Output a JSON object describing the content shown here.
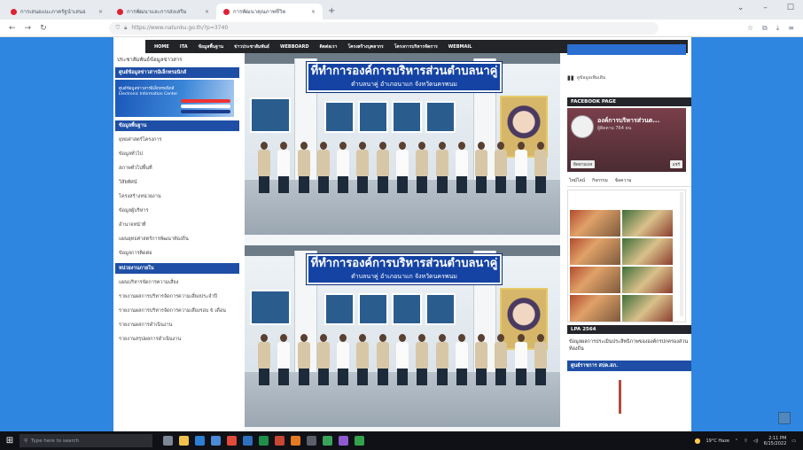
{
  "browser": {
    "tabs": [
      {
        "title": "การเสนอแนะภาครัฐนำเสนอ"
      },
      {
        "title": "การพัฒนาและการส่งเสริม"
      },
      {
        "title": "การพัฒนาคุณภาพชีวิต"
      }
    ],
    "new_tab_icon": "plus-icon",
    "url": "https://www.natunku.go.th/?p=3740"
  },
  "site": {
    "nav": [
      "HOME",
      "ITA",
      "ข้อมูลพื้นฐาน",
      "ข่าวประชาสัมพันธ์",
      "WEBBOARD",
      "ติดต่อเรา",
      "โครงสร้างบุคลากร",
      "โครงการบริหารจัดการ",
      "WEBMAIL"
    ],
    "left": {
      "intro": "ประชาสัมพันธ์ข้อมูลข่าวสาร",
      "sec1": "ศูนย์ข้อมูลข่าวสารอิเล็กทรอนิกส์",
      "banner_line1": "ศูนย์ข้อมูลข่าวสารอิเล็กทรอนิกส์",
      "banner_line2": "Electronic Information Center",
      "sec2": "ข้อมูลพื้นฐาน",
      "links1": [
        "ยุทธศาสตร์โครงการ",
        "ข้อมูลทั่วไป",
        "สภาพทั่วไปพื้นที่",
        "วิสัยทัศน์",
        "โครงสร้างหน่วยงาน",
        "ข้อมูลผู้บริหาร",
        "อำนาจหน้าที่",
        "แผนยุทธศาสตร์การพัฒนาท้องถิ่น",
        "ข้อมูลการติดต่อ"
      ],
      "sec3": "หน่วยงานภายใน",
      "links2": [
        "แผนบริหารจัดการความเสี่ยง",
        "รายงานผลการบริหารจัดการความเสี่ยงประจำปี",
        "รายงานผลการบริหารจัดการความเสี่ยงรอบ 6 เดือน",
        "รายงานผลการดำเนินงาน",
        "รายงานสรุปผลการดำเนินงาน"
      ]
    },
    "photo": {
      "sign_line1": "ที่ทำการองค์การบริหารส่วนตำบลนาคู่",
      "sign_line2": "ตำบลนาคู่ อำเภอนาแก จังหวัดนครพนม"
    },
    "right": {
      "stats": "ดูข้อมูลเพิ่มเติม",
      "fb_head": "FACEBOOK PAGE",
      "fb_name": "องค์การบริหารส่วนต...",
      "fb_sub": "ผู้ติดตาม 764 คน",
      "fb_follow": "ติดตามเพจ",
      "fb_share": "แชร์",
      "fb_tabs": [
        "ไทม์ไลน์",
        "กิจกรรม",
        "ข้อความ"
      ],
      "lpa_head": "LPA 2564",
      "lpa_text": "ข้อมูลผลการประเมินประสิทธิภาพขององค์กรปกครองส่วนท้องถิ่น",
      "gov_head": "ศูนย์ราชการ สปค.สภ."
    }
  },
  "taskbar": {
    "search": "Type here to search",
    "weather": "19°C Haze",
    "time": "2:11 PM",
    "date": "6/15/2022"
  }
}
